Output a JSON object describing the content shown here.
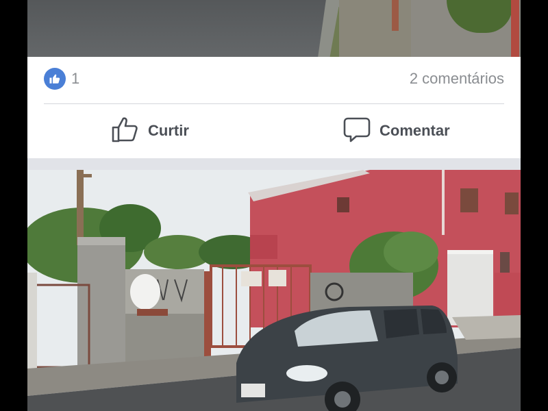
{
  "post": {
    "like_count": "1",
    "comments_text": "2 comentários",
    "like_label": "Curtir",
    "comment_label": "Comentar"
  },
  "icons": {
    "reaction": "thumbs-up-icon",
    "like_action": "thumbs-up-outline-icon",
    "comment_action": "speech-bubble-icon"
  },
  "colors": {
    "like_blue": "#4a7fd6",
    "muted_text": "#8a8d91",
    "action_text": "#4b4f56",
    "feed_background": "#e9ebee"
  }
}
